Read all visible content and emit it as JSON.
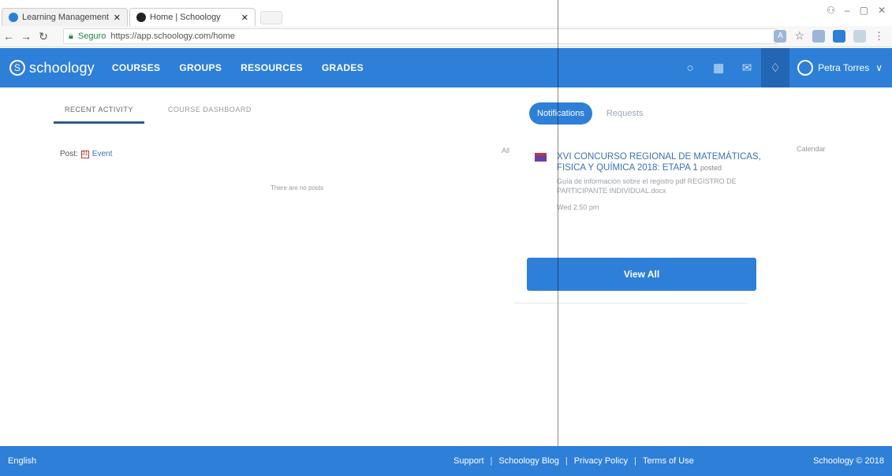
{
  "browser": {
    "tabs": [
      {
        "title": "Learning Management"
      },
      {
        "title": "Home | Schoology"
      }
    ],
    "secure_label": "Seguro",
    "url": "https://app.schoology.com/home"
  },
  "nav": {
    "logo_text": "schoology",
    "logo_badge": "S",
    "items": [
      "COURSES",
      "GROUPS",
      "RESOURCES",
      "GRADES"
    ],
    "user_name": "Petra Torres"
  },
  "activity": {
    "tabs": [
      "RECENT ACTIVITY",
      "COURSE DASHBOARD"
    ],
    "post_label": "Post:",
    "post_event": "Event",
    "filter_label": "All",
    "empty_text": "There are no posts"
  },
  "notifications": {
    "tabs": [
      "Notifications",
      "Requests"
    ],
    "calendar_link": "Calendar",
    "item": {
      "title": "XVI CONCURSO REGIONAL DE MATEMÁTICAS, FISICA Y QUÍMICA 2018: ETAPA 1",
      "posted": "posted",
      "body": "Guía de información sobre el registro pdf REGISTRO DE PARTICIPANTE INDIVIDUAL.docx",
      "time": "Wed 2:50 pm"
    },
    "view_all": "View All"
  },
  "footer": {
    "language": "English",
    "links": [
      "Support",
      "Schoology Blog",
      "Privacy Policy",
      "Terms of Use"
    ],
    "copyright": "Schoology © 2018"
  }
}
